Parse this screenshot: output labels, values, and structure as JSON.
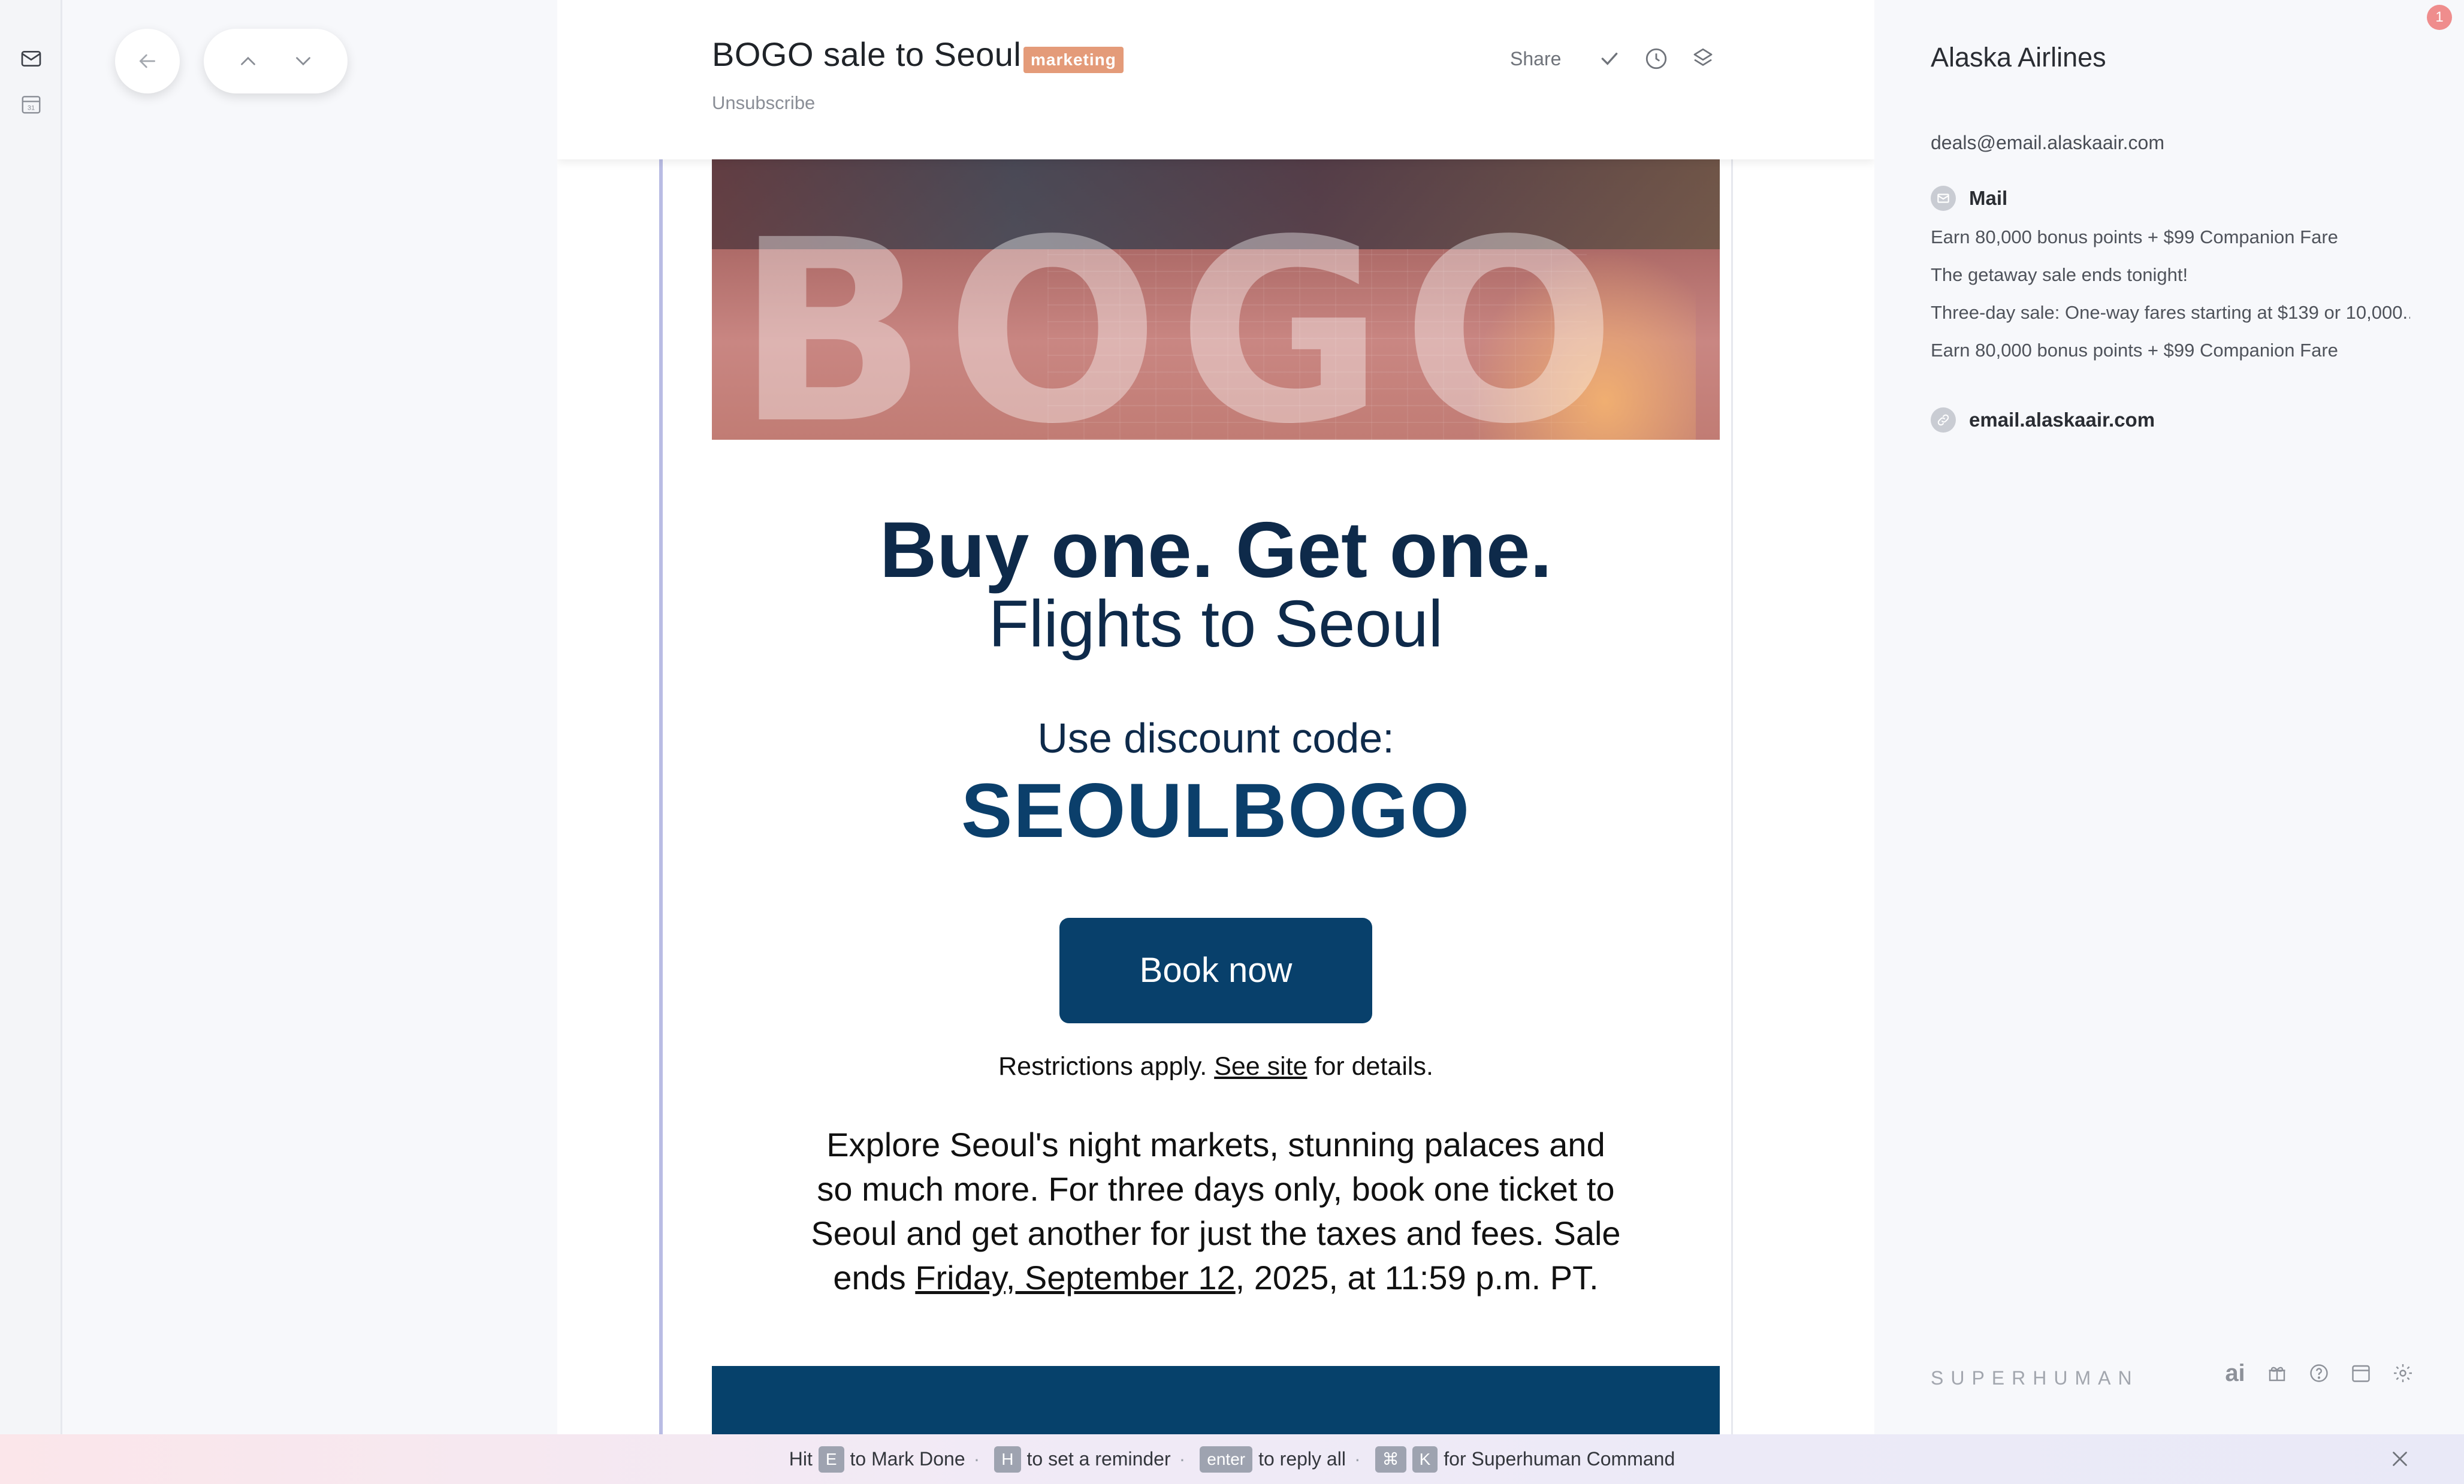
{
  "app": {
    "notification_count": "1",
    "brand": "SUPERHUMAN"
  },
  "rail": {
    "items": [
      {
        "icon": "mail-icon"
      },
      {
        "icon": "calendar-icon",
        "day": "31"
      }
    ]
  },
  "message": {
    "subject": "BOGO sale to Seoul",
    "label": "marketing",
    "unsubscribe": "Unsubscribe",
    "share": "Share",
    "hero_word": "BOGO",
    "headline": "Buy one. Get one.",
    "subline": "Flights to Seoul",
    "code_label": "Use discount code:",
    "code": "SEOULBOGO",
    "cta": "Book now",
    "restrictions_pre": "Restrictions apply.",
    "restrictions_link": "See site",
    "restrictions_post": "for details.",
    "body_pre": "Explore Seoul's night markets, stunning palaces and so much more. For three days only, book one ticket to Seoul and get another for just the taxes and fees. Sale ends",
    "body_date": "Friday, September 12",
    "body_post": ", 2025, at 11:59 p.m. PT."
  },
  "contact": {
    "name": "Alaska Airlines",
    "email": "deals@email.alaskaair.com",
    "mail_section_title": "Mail",
    "mail_items": [
      "Earn 80,000 bonus points + $99 Companion Fare",
      "The getaway sale ends tonight!",
      "Three-day sale: One-way fares starting at $139 or 10,000...",
      "Earn 80,000 bonus points + $99 Companion Fare"
    ],
    "domain": "email.alaskaair.com"
  },
  "footer_icons": {
    "ai_label": "ai"
  },
  "hintbar": {
    "hit": "Hit",
    "key_e": "E",
    "mark_done": "to Mark Done",
    "key_h": "H",
    "reminder": "to set a reminder",
    "key_enter": "enter",
    "reply_all": "to reply all",
    "key_cmd": "⌘",
    "key_k": "K",
    "command": "for Superhuman Command"
  },
  "colors": {
    "cta_bg": "#08406b",
    "label_bg": "#e49b79",
    "headline": "#0e2a4a"
  }
}
